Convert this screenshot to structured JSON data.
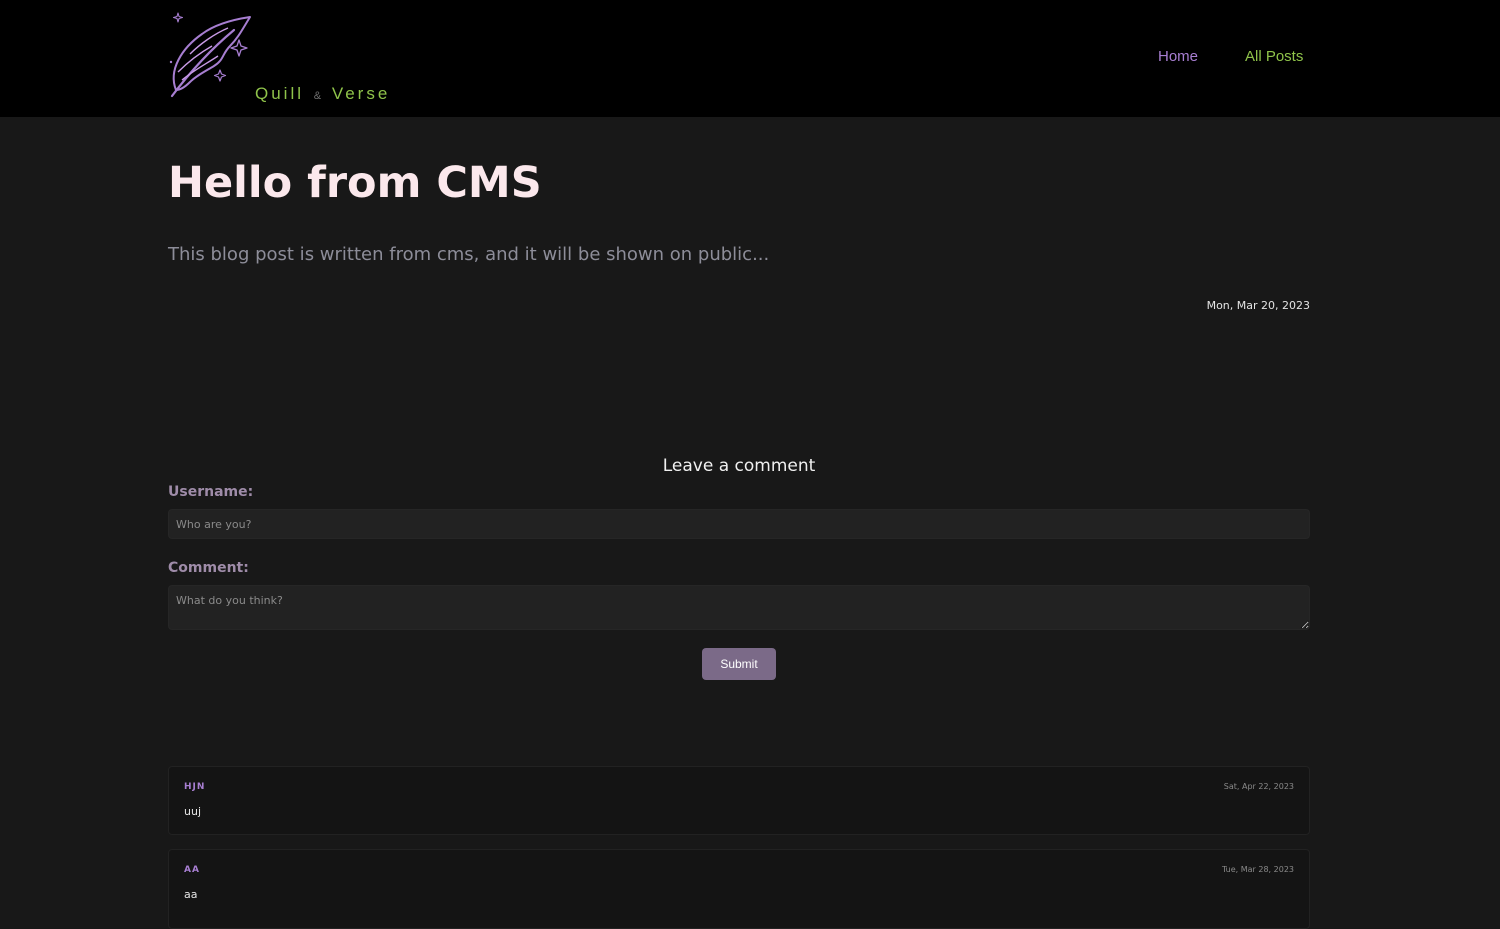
{
  "header": {
    "brand_word_1": "Quill",
    "brand_amp": "&",
    "brand_word_2": "Verse",
    "logo_icon": "quill-feather-sparkles-icon",
    "nav": [
      {
        "label": "Home"
      },
      {
        "label": "All Posts"
      }
    ]
  },
  "post": {
    "title": "Hello from CMS",
    "excerpt": "This blog post is written from cms, and it will be shown on public...",
    "date": "Mon, Mar 20, 2023"
  },
  "comment_form": {
    "heading": "Leave a comment",
    "username_label": "Username:",
    "username_placeholder": "Who are you?",
    "comment_label": "Comment:",
    "comment_placeholder": "What do you think?",
    "submit_label": "Submit"
  },
  "comments": [
    {
      "user": "HJN",
      "date": "Sat, Apr 22, 2023",
      "text": "uuj"
    },
    {
      "user": "AA",
      "date": "Tue, Mar 28, 2023",
      "text": "aa"
    }
  ],
  "colors": {
    "header_bg": "#000000",
    "page_bg": "#181818",
    "accent_purple": "#a77ed1",
    "accent_green": "#8fc34a",
    "title": "#fbe8ec",
    "button": "#7b6a88"
  }
}
